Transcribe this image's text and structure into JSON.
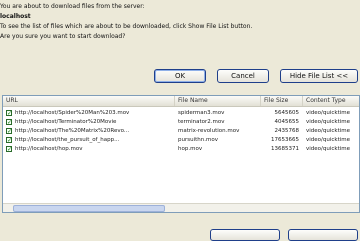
{
  "messages": {
    "line1": "You are about to download files from the server:",
    "server": "localhost",
    "line3": "To see the list of files which are about to be downloaded, click Show File List button.",
    "line4": "Are you sure you want to start download?"
  },
  "buttons": {
    "ok": "OK",
    "cancel": "Cancel",
    "hide_list": "Hide File List <<"
  },
  "table": {
    "columns": [
      "URL",
      "File Name",
      "File Size",
      "Content Type"
    ],
    "rows": [
      {
        "url": "http://localhost/Spider%20Man%203.mov",
        "name": "spiderman3.mov",
        "size": "5645605",
        "type": "video/quicktime",
        "checked": true
      },
      {
        "url": "http://localhost/Terminator%20Movie",
        "name": "terminator2.mov",
        "size": "4045655",
        "type": "video/quicktime",
        "checked": true
      },
      {
        "url": "http://localhost/The%20Matrix%20Revo...",
        "name": "matrix-revolution.mov",
        "size": "2435768",
        "type": "video/quicktime",
        "checked": true
      },
      {
        "url": "http://localhost/the_pursuit_of_happ...",
        "name": "pursuithn.mov",
        "size": "17653665",
        "type": "video/quicktime",
        "checked": true
      },
      {
        "url": "http://localhost/hop.mov",
        "name": "hop.mov",
        "size": "13685371",
        "type": "video/quicktime",
        "checked": true
      }
    ]
  },
  "icons": {
    "checkbox": "checkmark-icon"
  }
}
